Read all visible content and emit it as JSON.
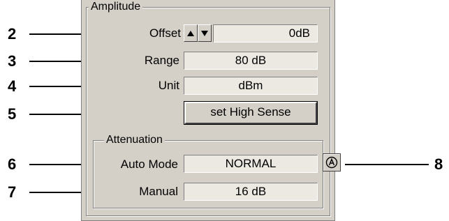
{
  "amplitude": {
    "title": "Amplitude",
    "offset_label": "Offset",
    "offset_value": "0dB",
    "range_label": "Range",
    "range_value": "80 dB",
    "unit_label": "Unit",
    "unit_value": "dBm",
    "high_sense_button": "set High Sense"
  },
  "attenuation": {
    "title": "Attenuation",
    "auto_mode_label": "Auto Mode",
    "auto_mode_value": "NORMAL",
    "manual_label": "Manual",
    "manual_value": "16 dB"
  },
  "callouts": [
    "2",
    "3",
    "4",
    "5",
    "6",
    "7",
    "8"
  ],
  "icons": {
    "spin_up": "triangle-up-icon",
    "spin_down": "triangle-down-icon",
    "auto_toggle": "circled-a-icon"
  },
  "colors": {
    "panel": "#d4d0c8",
    "field": "#ece9e2",
    "callout": "#000000"
  }
}
